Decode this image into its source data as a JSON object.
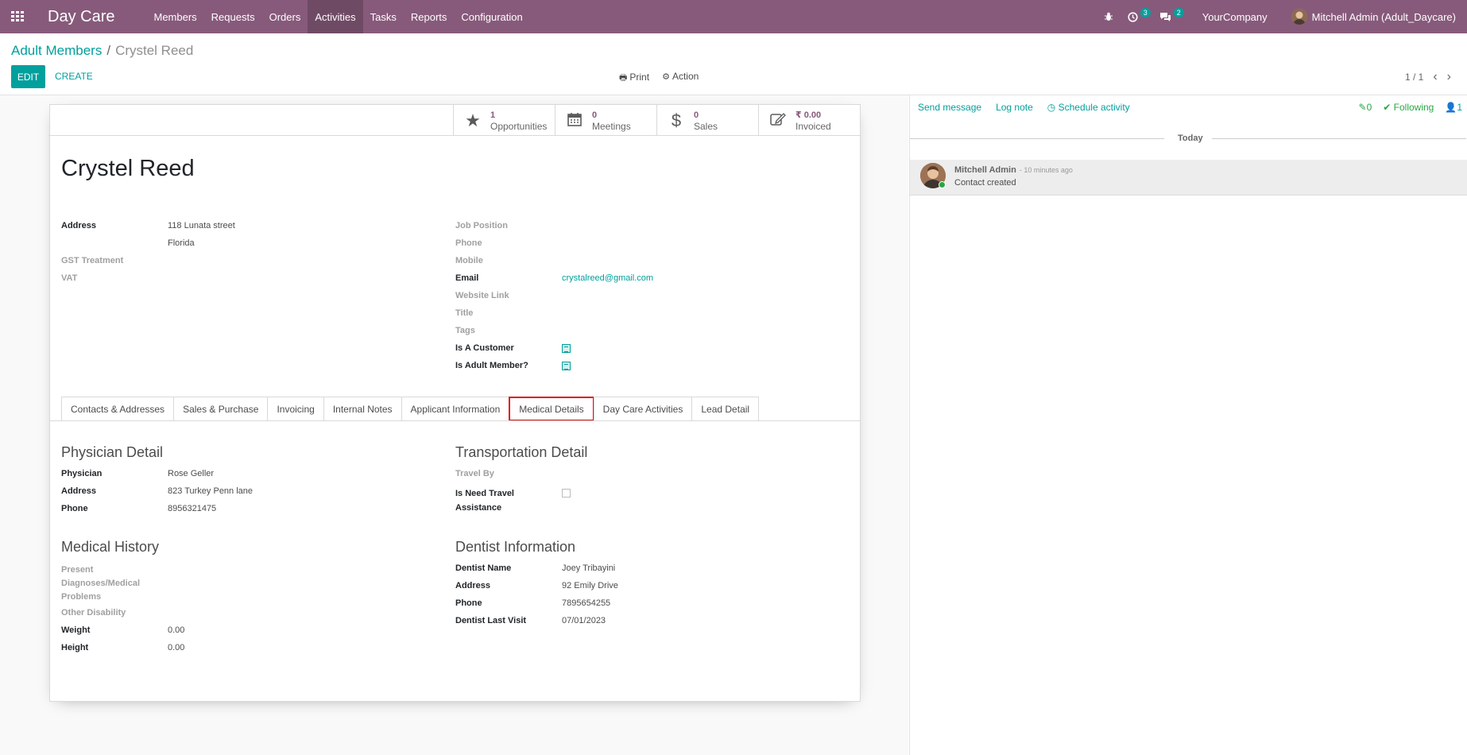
{
  "navbar": {
    "brand": "Day Care",
    "menu": [
      "Members",
      "Requests",
      "Orders",
      "Activities",
      "Tasks",
      "Reports",
      "Configuration"
    ],
    "active_menu": "Activities",
    "activity_count": "3",
    "message_count": "2",
    "company": "YourCompany",
    "user": "Mitchell Admin (Adult_Daycare)"
  },
  "control": {
    "breadcrumb_parent": "Adult Members",
    "breadcrumb_sep": "/",
    "breadcrumb_current": "Crystel Reed",
    "edit_label": "EDIT",
    "create_label": "CREATE",
    "print_label": "Print",
    "action_label": "Action",
    "pager": "1 / 1"
  },
  "stats": [
    {
      "value": "1",
      "label": "Opportunities",
      "icon": "star-icon"
    },
    {
      "value": "0",
      "label": "Meetings",
      "icon": "calendar-icon"
    },
    {
      "value": "0",
      "label": "Sales",
      "icon": "dollar-icon"
    },
    {
      "value": "₹ 0.00",
      "label": "Invoiced",
      "icon": "edit-icon"
    }
  ],
  "partner": {
    "name": "Crystel Reed",
    "address_label": "Address",
    "street": "118 Lunata street",
    "state": "Florida",
    "gst_label": "GST Treatment",
    "vat_label": "VAT",
    "job_label": "Job Position",
    "phone_label": "Phone",
    "mobile_label": "Mobile",
    "email_label": "Email",
    "email": "crystalreed@gmail.com",
    "website_label": "Website Link",
    "title_label": "Title",
    "tags_label": "Tags",
    "customer_label": "Is A Customer",
    "adult_label": "Is Adult Member?"
  },
  "tabs": [
    "Contacts & Addresses",
    "Sales & Purchase",
    "Invoicing",
    "Internal Notes",
    "Applicant Information",
    "Medical Details",
    "Day Care Activities",
    "Lead Detail"
  ],
  "active_tab": "Medical Details",
  "physician": {
    "title": "Physician Detail",
    "name_label": "Physician",
    "name": "Rose Geller",
    "address_label": "Address",
    "address": "823 Turkey Penn lane",
    "phone_label": "Phone",
    "phone": "8956321475"
  },
  "transport": {
    "title": "Transportation Detail",
    "travel_by_label": "Travel By",
    "need_travel_label_1": "Is Need Travel",
    "need_travel_label_2": "Assistance"
  },
  "medical": {
    "title": "Medical History",
    "present_1": "Present",
    "present_2": "Diagnoses/Medical",
    "present_3": "Problems",
    "disability_label": "Other Disability",
    "weight_label": "Weight",
    "weight": "0.00",
    "height_label": "Height",
    "height": "0.00"
  },
  "dentist": {
    "title": "Dentist Information",
    "name_label": "Dentist Name",
    "name": "Joey Tribayini",
    "address_label": "Address",
    "address": "92 Emily Drive",
    "phone_label": "Phone",
    "phone": "7895654255",
    "visit_label": "Dentist Last Visit",
    "visit": "07/01/2023"
  },
  "chatter": {
    "send_message": "Send message",
    "log_note": "Log note",
    "schedule_activity": "Schedule activity",
    "attachments": "0",
    "following": "Following",
    "followers": "1",
    "today": "Today",
    "author": "Mitchell Admin",
    "time": "- 10 minutes ago",
    "body": "Contact created"
  },
  "colors": {
    "brand": "#875a7b",
    "accent": "#00a09d",
    "highlight": "#e01010"
  }
}
